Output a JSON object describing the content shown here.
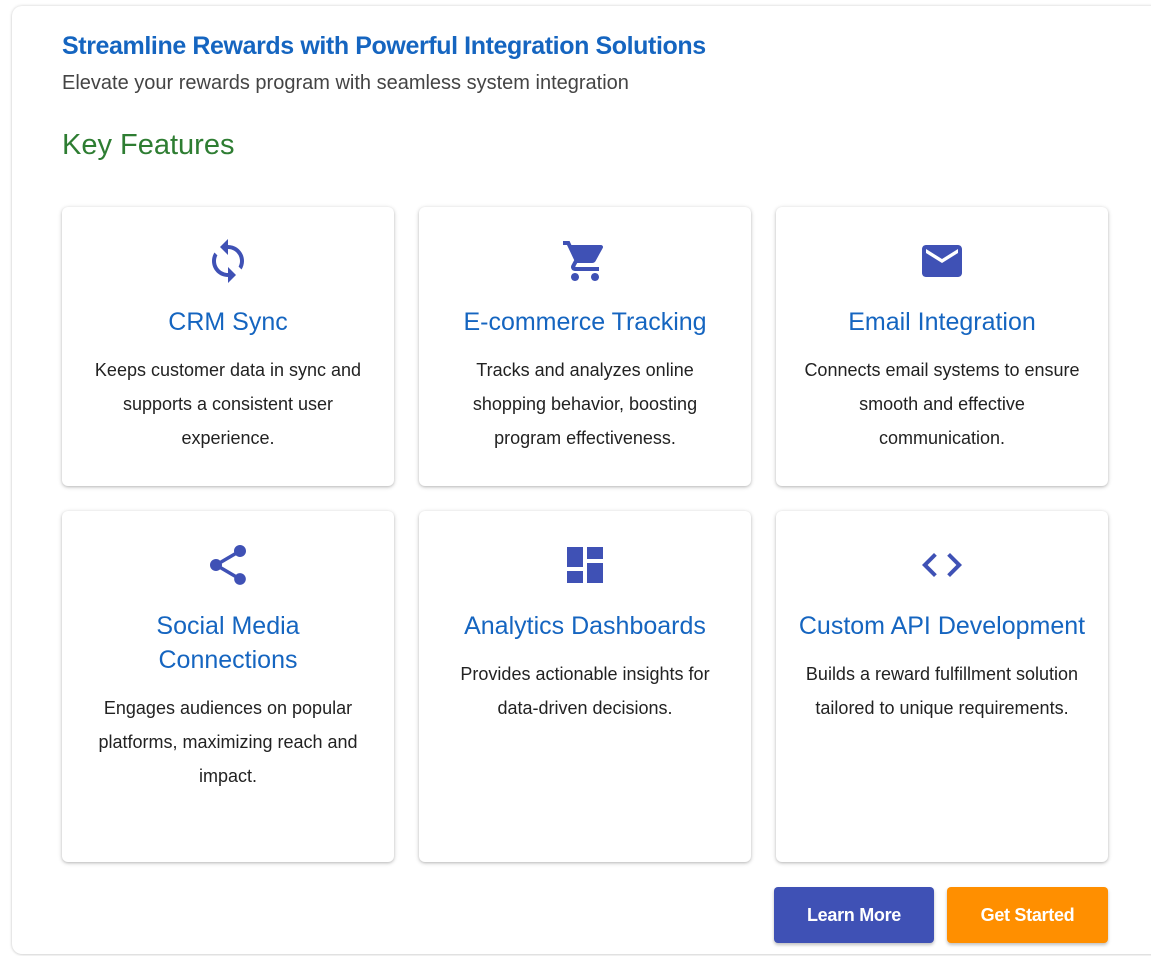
{
  "header": {
    "title": "Streamline Rewards with Powerful Integration Solutions",
    "subtitle": "Elevate your rewards program with seamless system integration"
  },
  "features": {
    "section_title": "Key Features",
    "icon_color": "#3f51b5",
    "items": [
      {
        "icon": "sync-icon",
        "title": "CRM Sync",
        "description": "Keeps customer data in sync and supports a consistent user experience."
      },
      {
        "icon": "shopping-cart-icon",
        "title": "E-commerce Tracking",
        "description": "Tracks and analyzes online shopping behavior, boosting program effectiveness."
      },
      {
        "icon": "email-icon",
        "title": "Email Integration",
        "description": "Connects email systems to ensure smooth and effective communication."
      },
      {
        "icon": "share-icon",
        "title": "Social Media Connections",
        "description": "Engages audiences on popular platforms, maximizing reach and impact."
      },
      {
        "icon": "dashboard-icon",
        "title": "Analytics Dashboards",
        "description": "Provides actionable insights for data-driven decisions."
      },
      {
        "icon": "code-icon",
        "title": "Custom API Development",
        "description": "Builds a reward fulfillment solution tailored to unique requirements."
      }
    ]
  },
  "actions": {
    "learn_more": "Learn More",
    "get_started": "Get Started",
    "learn_more_color": "#3f51b5",
    "get_started_color": "#ff8f00"
  }
}
